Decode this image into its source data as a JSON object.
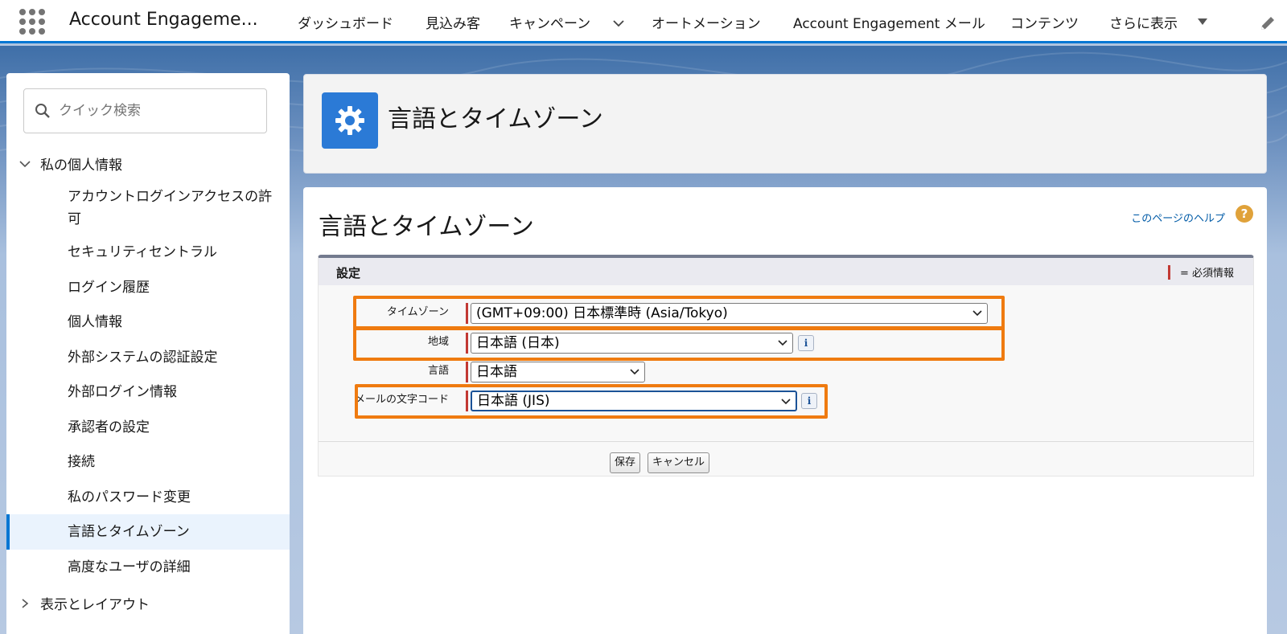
{
  "app": {
    "name": "Account Engageme..."
  },
  "nav": {
    "items": [
      {
        "label": "ダッシュボード"
      },
      {
        "label": "見込み客"
      },
      {
        "label": "キャンペーン"
      },
      {
        "label": "オートメーション"
      },
      {
        "label": "Account Engagement メール"
      },
      {
        "label": "コンテンツ"
      },
      {
        "label": "さらに表示"
      }
    ]
  },
  "sidebar": {
    "search_placeholder": "クイック検索",
    "section_personal": "私の個人情報",
    "items": [
      {
        "label": "アカウントログインアクセスの許可"
      },
      {
        "label": "セキュリティセントラル"
      },
      {
        "label": "ログイン履歴"
      },
      {
        "label": "個人情報"
      },
      {
        "label": "外部システムの認証設定"
      },
      {
        "label": "外部ログイン情報"
      },
      {
        "label": "承認者の設定"
      },
      {
        "label": "接続"
      },
      {
        "label": "私のパスワード変更"
      },
      {
        "label": "言語とタイムゾーン"
      },
      {
        "label": "高度なユーザの詳細"
      }
    ],
    "active_index": 9,
    "section_display": "表示とレイアウト"
  },
  "header": {
    "title": "言語とタイムゾーン"
  },
  "main": {
    "title": "言語とタイムゾーン",
    "help_link": "このページのヘルプ",
    "help_icon": "?",
    "section_title": "設定",
    "required_legend": "= 必須情報",
    "fields": {
      "timezone": {
        "label": "タイムゾーン",
        "value": "(GMT+09:00) 日本標準時 (Asia/Tokyo)"
      },
      "locale": {
        "label": "地域",
        "value": "日本語 (日本)"
      },
      "language": {
        "label": "言語",
        "value": "日本語"
      },
      "encoding": {
        "label": "メールの文字コード",
        "value": "日本語 (JIS)"
      }
    },
    "info_glyph": "i",
    "save_label": "保存",
    "cancel_label": "キャンセル"
  },
  "colors": {
    "brand": "#0176d3",
    "highlight": "#ef7b10",
    "required": "#c23934",
    "gear_tile": "#2b7ad6"
  }
}
